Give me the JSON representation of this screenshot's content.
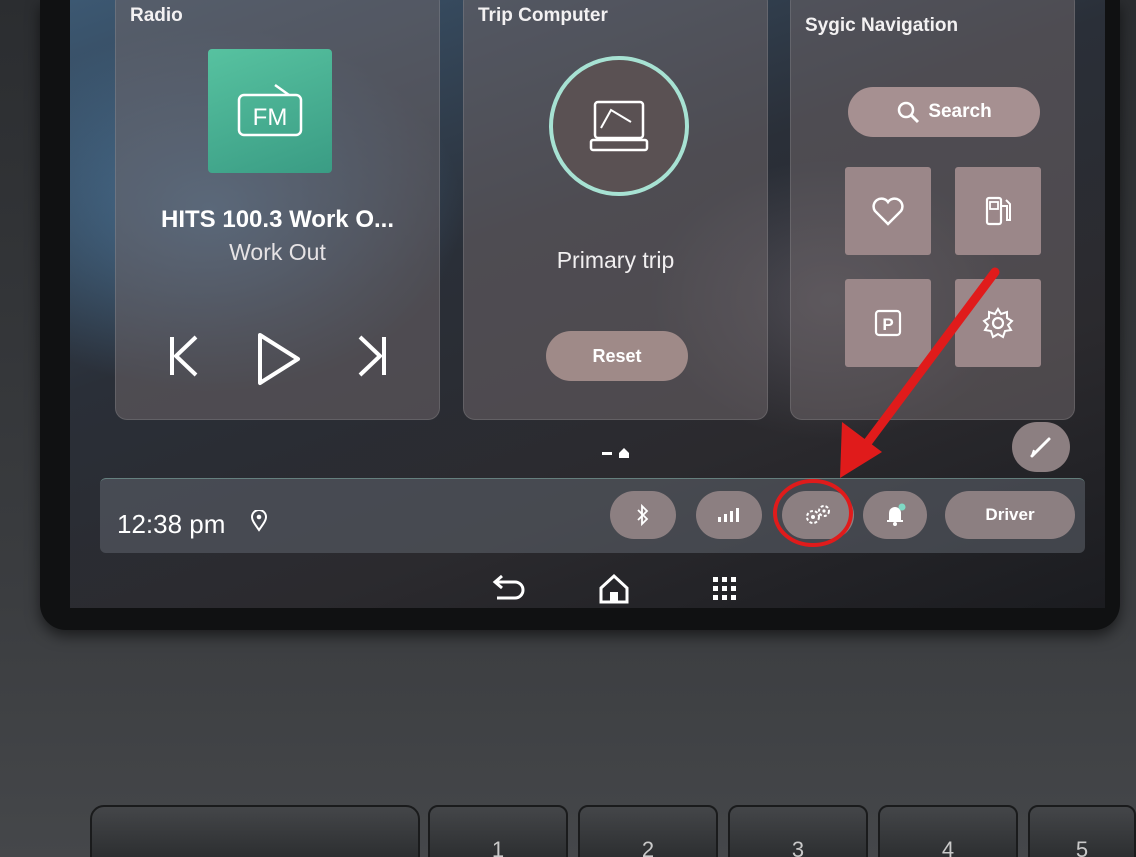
{
  "radio": {
    "title": "Radio",
    "logo_text": "FM",
    "station": "HITS 100.3 Work O...",
    "program": "Work Out",
    "controls": [
      "previous-icon",
      "play-icon",
      "next-icon"
    ]
  },
  "trip": {
    "title": "Trip Computer",
    "label": "Primary trip",
    "reset_label": "Reset"
  },
  "nav": {
    "title": "Sygic Navigation",
    "search_label": "Search",
    "parking_label": "P",
    "tiles": [
      "heart-icon",
      "fuel-icon",
      "parking-icon",
      "gear-icon"
    ]
  },
  "status": {
    "time": "12:38 pm",
    "driver_label": "Driver"
  },
  "presets": [
    "1",
    "2",
    "3",
    "4",
    "5"
  ],
  "colors": {
    "accent_teal": "#a7e2d3",
    "fm_tile": "#4fb796",
    "annotation_red": "#e01b1b",
    "pill": "#8c7f81"
  }
}
